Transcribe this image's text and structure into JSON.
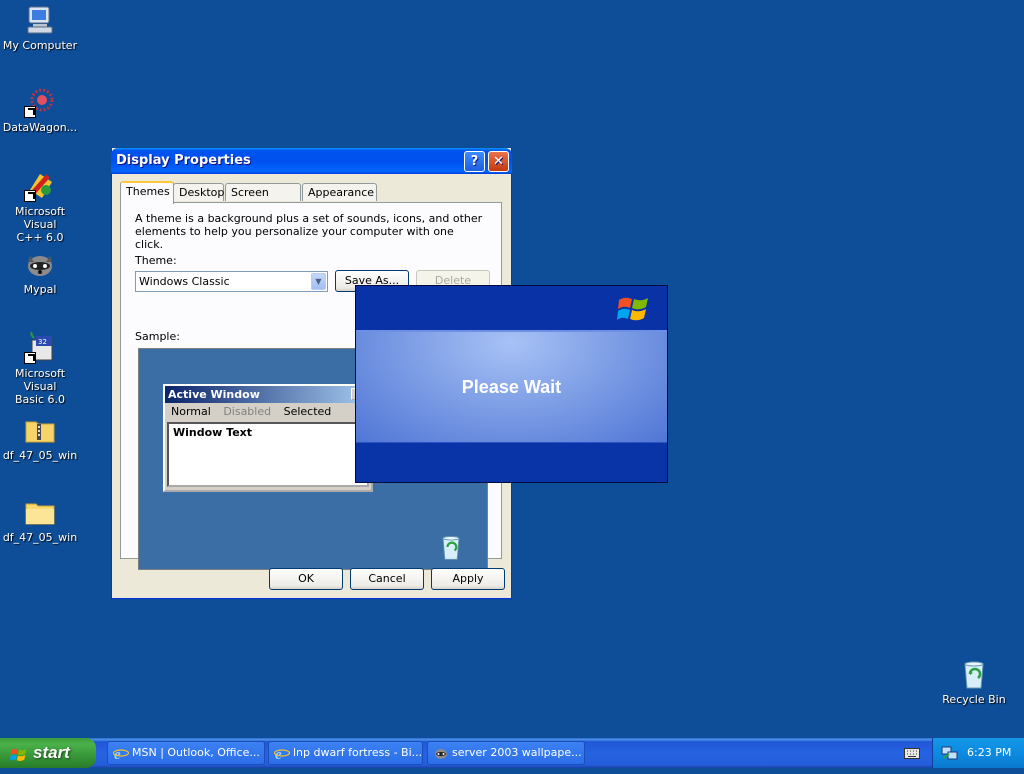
{
  "desktop": {
    "background": "#0e4e98",
    "icons": [
      {
        "label": "My Computer"
      },
      {
        "label": "DataWagon..."
      },
      {
        "label": "Microsoft Visual\nC++ 6.0"
      },
      {
        "label": "Mypal"
      },
      {
        "label": "Microsoft Visual\nBasic 6.0"
      },
      {
        "label": "df_47_05_win"
      },
      {
        "label": "df_47_05_win"
      },
      {
        "label": "Recycle Bin"
      }
    ]
  },
  "display_properties": {
    "title": "Display Properties",
    "help_glyph": "?",
    "close_glyph": "✕",
    "tabs": [
      {
        "label": "Themes",
        "active": true
      },
      {
        "label": "Desktop"
      },
      {
        "label": "Screen Saver"
      },
      {
        "label": "Appearance"
      }
    ],
    "description": "A theme is a background plus a set of sounds, icons, and other elements to help you personalize your computer with one click.",
    "theme_label": "Theme:",
    "theme_value": "Windows Classic",
    "save_as_label": "Save As...",
    "delete_label": "Delete",
    "sample_label": "Sample:",
    "sample": {
      "window_title": "Active Window",
      "menu_normal": "Normal",
      "menu_disabled": "Disabled",
      "menu_selected": "Selected",
      "window_text": "Window Text"
    },
    "ok_label": "OK",
    "cancel_label": "Cancel",
    "apply_label": "Apply"
  },
  "splash": {
    "text": "Please Wait"
  },
  "taskbar": {
    "start_label": "start",
    "tasks": [
      {
        "label": "MSN | Outlook, Office...",
        "icon": "ie-icon"
      },
      {
        "label": "lnp dwarf fortress - Bi...",
        "icon": "ie-icon"
      },
      {
        "label": "server 2003 wallpape...",
        "icon": "mypal-icon"
      }
    ],
    "clock": "6:23 PM"
  }
}
